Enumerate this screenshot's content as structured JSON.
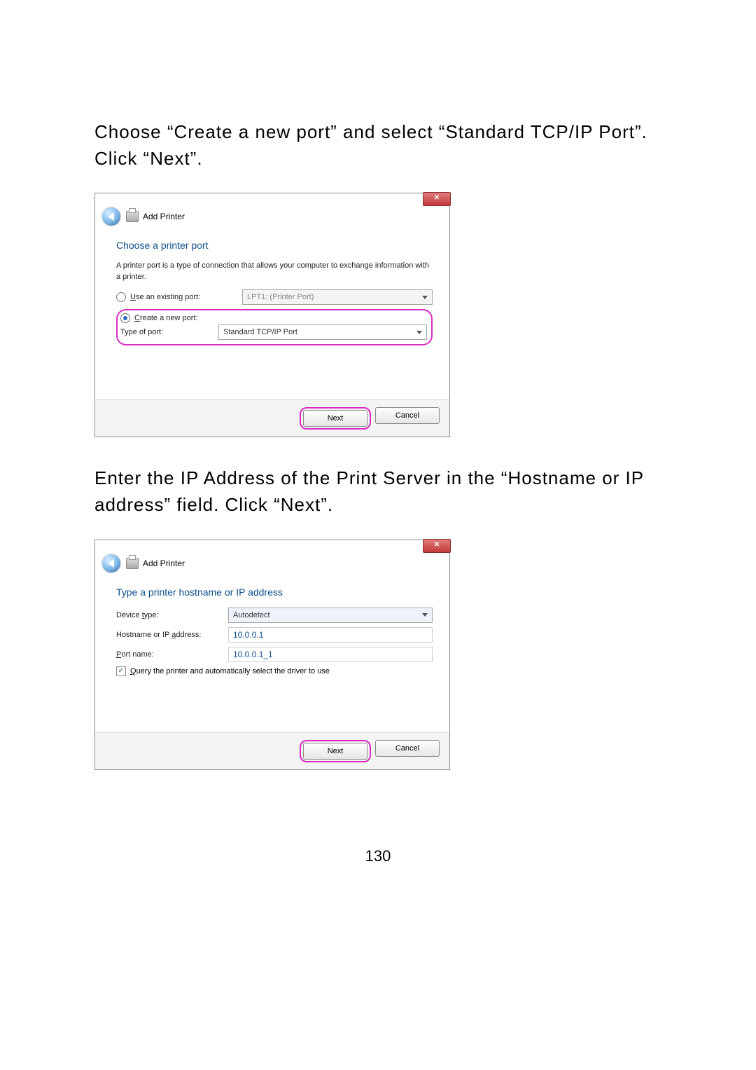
{
  "para1": "Choose “Create a new port” and select “Standard TCP/IP Port”. Click “Next”.",
  "para2": "Enter the IP Address of the Print Server in the “Hostname or IP address” field. Click “Next”.",
  "page_number": "130",
  "close_glyph": "✕",
  "dialog1": {
    "title": "Add Printer",
    "heading": "Choose a printer port",
    "description": "A printer port is a type of connection that allows your computer to exchange information with a printer.",
    "use_existing_label": "Use an existing port:",
    "use_existing_value": "LPT1: (Printer Port)",
    "create_new_label": "Create a new port:",
    "type_of_port_label": "Type of port:",
    "type_of_port_value": "Standard TCP/IP Port",
    "next": "Next",
    "cancel": "Cancel"
  },
  "dialog2": {
    "title": "Add Printer",
    "heading": "Type a printer hostname or IP address",
    "device_type_label": "Device type:",
    "device_type_value": "Autodetect",
    "hostname_label": "Hostname or IP address:",
    "hostname_value": "10.0.0.1",
    "port_name_label": "Port name:",
    "port_name_value": "10.0.0.1_1",
    "query_label": "Query the printer and automatically select the driver to use",
    "next": "Next",
    "cancel": "Cancel"
  }
}
